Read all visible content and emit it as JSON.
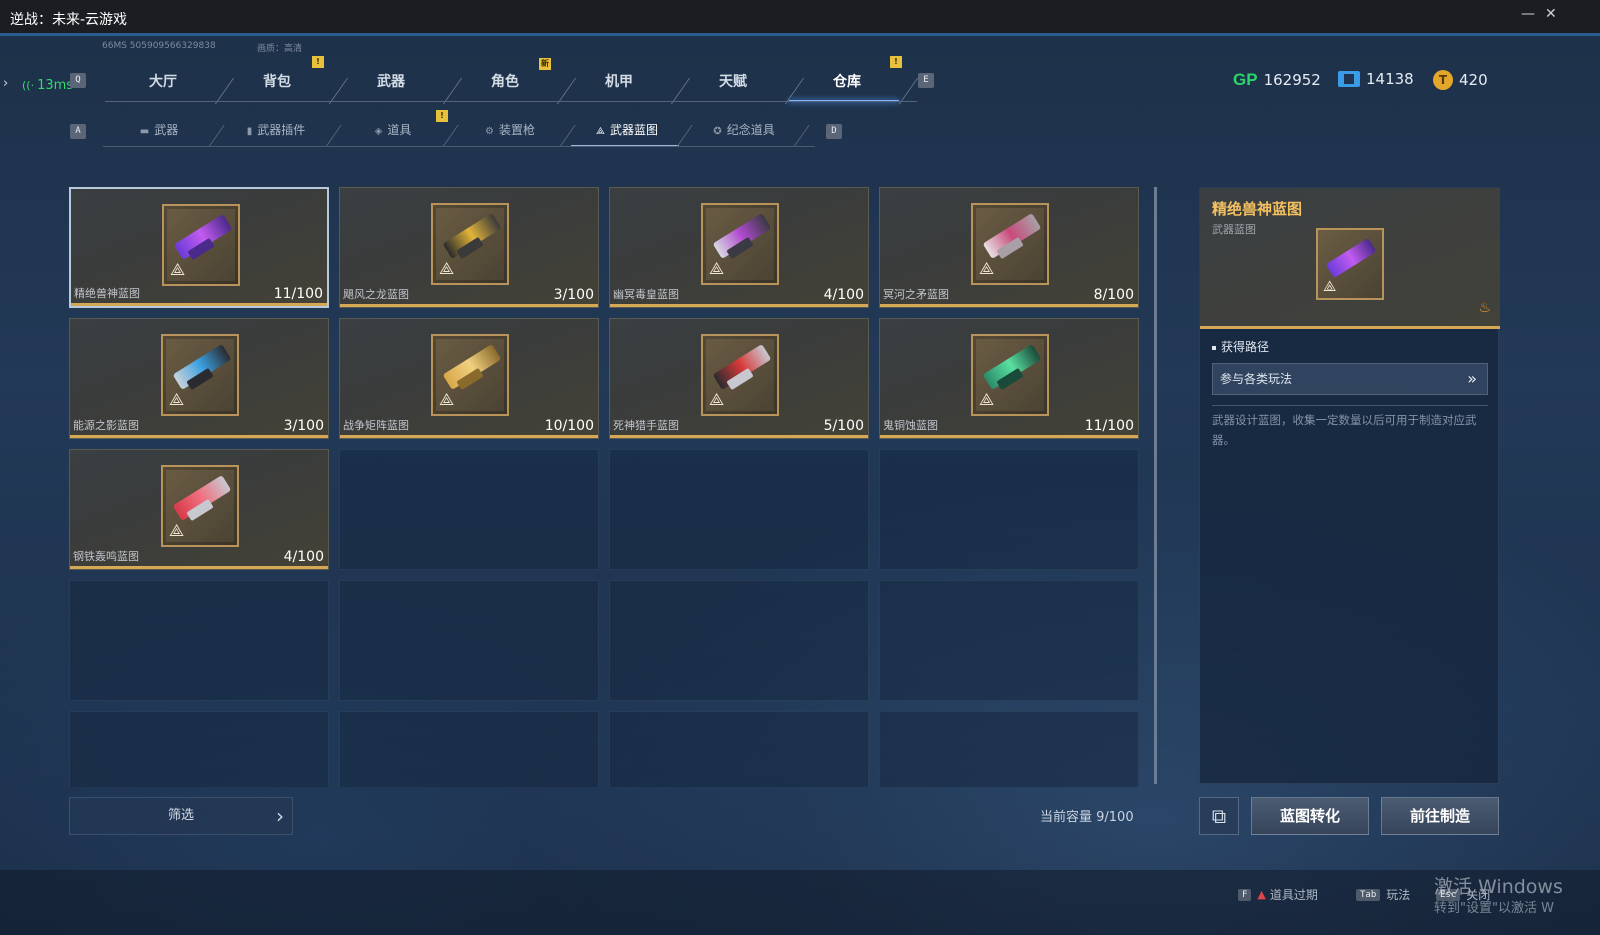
{
  "window": {
    "title": "逆战：未来-云游戏",
    "minimize": "—",
    "close": "✕",
    "meta_left": "66MS  505909566329838",
    "meta_right": "画质：高清"
  },
  "status": {
    "ping": "13ms",
    "ping_color": "#35d96b"
  },
  "keys": {
    "main_prev": "Q",
    "main_next": "E",
    "sub_prev": "A",
    "sub_next": "D"
  },
  "main_tabs": [
    {
      "label": "大厅"
    },
    {
      "label": "背包",
      "badge": "!"
    },
    {
      "label": "武器"
    },
    {
      "label": "角色",
      "badge": "新"
    },
    {
      "label": "机甲"
    },
    {
      "label": "天赋"
    },
    {
      "label": "仓库",
      "badge": "!",
      "active": true
    }
  ],
  "currency": [
    {
      "icon": "gp-icon",
      "symbol": "GP",
      "value": "162952"
    },
    {
      "icon": "ticket-icon",
      "value": "14138"
    },
    {
      "icon": "coin-icon",
      "symbol": "T",
      "value": "420"
    }
  ],
  "sub_tabs": [
    {
      "label": "武器",
      "icon": "rifle-icon"
    },
    {
      "label": "武器插件",
      "icon": "attachment-icon"
    },
    {
      "label": "道具",
      "icon": "item-icon",
      "badge": "!"
    },
    {
      "label": "装置枪",
      "icon": "device-gun-icon"
    },
    {
      "label": "武器蓝图",
      "icon": "blueprint-icon",
      "active": true
    },
    {
      "label": "纪念道具",
      "icon": "souvenir-icon"
    }
  ],
  "blueprints": [
    {
      "name": "精绝兽神蓝图",
      "count": "11/100",
      "colors": [
        "#6a3bd8",
        "#c25cf0",
        "#4a2a8a"
      ],
      "selected": true
    },
    {
      "name": "飓风之龙蓝图",
      "count": "3/100",
      "colors": [
        "#2a2a2a",
        "#e2b43a",
        "#3a3a3a"
      ]
    },
    {
      "name": "幽冥毒皇蓝图",
      "count": "4/100",
      "colors": [
        "#d8d8e0",
        "#b04ad0",
        "#3a3a44"
      ]
    },
    {
      "name": "冥河之矛蓝图",
      "count": "8/100",
      "colors": [
        "#e8e0e4",
        "#c84a7a",
        "#a8a0a6"
      ]
    },
    {
      "name": "能源之影蓝图",
      "count": "3/100",
      "colors": [
        "#c8d2dc",
        "#3aa0e0",
        "#2a2a30"
      ]
    },
    {
      "name": "战争矩阵蓝图",
      "count": "10/100",
      "colors": [
        "#d8a84a",
        "#f0d080",
        "#8a6a2a"
      ]
    },
    {
      "name": "死神猎手蓝图",
      "count": "5/100",
      "colors": [
        "#2a2a2e",
        "#d83a3a",
        "#c8c8d0"
      ]
    },
    {
      "name": "鬼铜蚀蓝图",
      "count": "11/100",
      "colors": [
        "#2a8a6a",
        "#5ae0a0",
        "#1a4a3a"
      ]
    },
    {
      "name": "钢铁轰鸣蓝图",
      "count": "4/100",
      "colors": [
        "#d83a4a",
        "#f07080",
        "#c8c8d0"
      ]
    }
  ],
  "detail": {
    "title": "精绝兽神蓝图",
    "subtitle": "武器蓝图",
    "section_label": "获得路径",
    "route": "参与各类玩法",
    "description": "武器设计蓝图，收集一定数量以后可用于制造对应武器。"
  },
  "bottom": {
    "filter": "筛选",
    "capacity": "当前容量 9/100",
    "convert": "蓝图转化",
    "craft": "前往制造"
  },
  "footer": {
    "hints": [
      {
        "key": "F",
        "label": "道具过期",
        "warn": true
      },
      {
        "key": "Tab",
        "label": "玩法"
      },
      {
        "key": "Esc",
        "label": "关闭"
      }
    ],
    "watermark_line1": "激活 Windows",
    "watermark_line2": "转到\"设置\"以激活 W"
  },
  "colors": {
    "accent_gold": "#d4a855",
    "title_gold": "#f3c060",
    "active_blue": "#7fb6ff"
  }
}
